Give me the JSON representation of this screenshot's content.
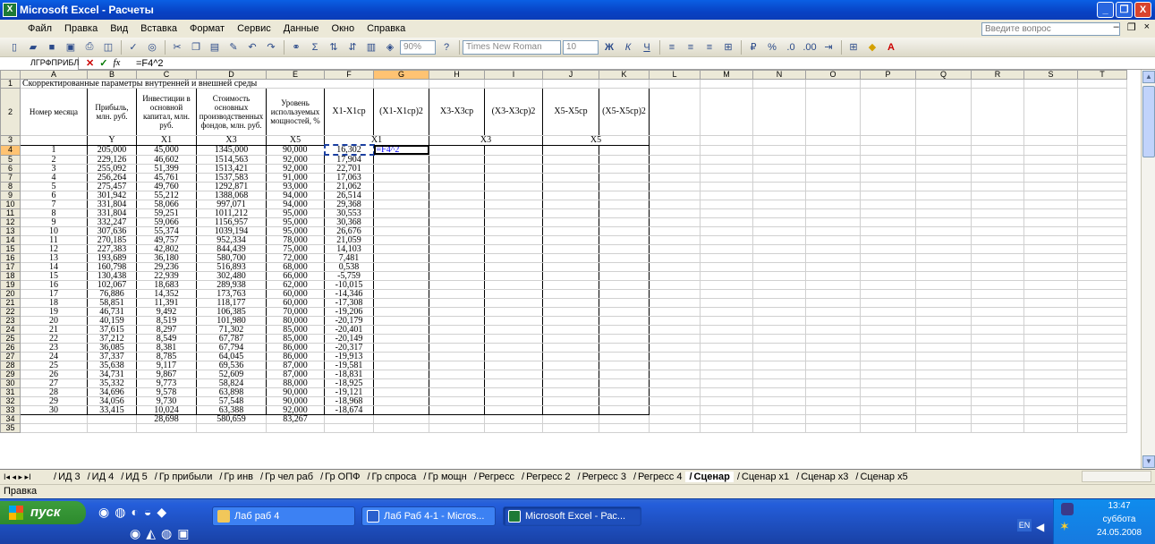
{
  "window": {
    "title": "Microsoft Excel - Расчеты",
    "minimize": "_",
    "restore": "❐",
    "close": "X"
  },
  "menu": [
    "Файл",
    "Правка",
    "Вид",
    "Вставка",
    "Формат",
    "Сервис",
    "Данные",
    "Окно",
    "Справка"
  ],
  "ask_placeholder": "Введите вопрос",
  "toolbar": {
    "zoom": "90%",
    "font": "Times New Roman",
    "size": "10",
    "bold": "Ж",
    "italic": "К",
    "underline": "Ч",
    "percent": "%"
  },
  "formula_bar": {
    "name_box": "ЛГРФПРИБЛ",
    "formula": "=F4^2",
    "cancel": "✕",
    "enter": "✓",
    "fx": "fx"
  },
  "columns": [
    "A",
    "B",
    "C",
    "D",
    "E",
    "F",
    "G",
    "H",
    "I",
    "J",
    "K",
    "L",
    "M",
    "N",
    "O",
    "P",
    "Q",
    "R",
    "S",
    "T"
  ],
  "sheet": {
    "title": "Скорректированные параметры внутренней и внешней среды",
    "headers": {
      "a": "Номер месяца",
      "b": "Прибыль, млн. руб.",
      "c": "Инвестиции в основной капитал, млн. руб.",
      "d": "Стоимость основных производственных фондов, млн. руб.",
      "e": "Уровень используемых мощностей, %",
      "f": "X1-X1ср",
      "g": "(X1-X1ср)2",
      "h": "X3-X3ср",
      "i": "(X3-X3ср)2",
      "j": "X5-X5ср",
      "k": "(X5-X5ср)2"
    },
    "vars": {
      "b": "Y",
      "c": "X1",
      "d": "X3",
      "e": "X5",
      "fg": "X1",
      "hi": "X3",
      "jk": "X5"
    },
    "editing_cell": "=F4^2",
    "rows": [
      [
        "1",
        "205,000",
        "45,000",
        "1345,000",
        "90,000",
        "16,302"
      ],
      [
        "2",
        "229,126",
        "46,602",
        "1514,563",
        "92,000",
        "17,904"
      ],
      [
        "3",
        "255,092",
        "51,399",
        "1513,421",
        "92,000",
        "22,701"
      ],
      [
        "4",
        "256,264",
        "45,761",
        "1537,583",
        "91,000",
        "17,063"
      ],
      [
        "5",
        "275,457",
        "49,760",
        "1292,871",
        "93,000",
        "21,062"
      ],
      [
        "6",
        "301,942",
        "55,212",
        "1388,068",
        "94,000",
        "26,514"
      ],
      [
        "7",
        "331,804",
        "58,066",
        "997,071",
        "94,000",
        "29,368"
      ],
      [
        "8",
        "331,804",
        "59,251",
        "1011,212",
        "95,000",
        "30,553"
      ],
      [
        "9",
        "332,247",
        "59,066",
        "1156,957",
        "95,000",
        "30,368"
      ],
      [
        "10",
        "307,636",
        "55,374",
        "1039,194",
        "95,000",
        "26,676"
      ],
      [
        "11",
        "270,185",
        "49,757",
        "952,334",
        "78,000",
        "21,059"
      ],
      [
        "12",
        "227,383",
        "42,802",
        "844,439",
        "75,000",
        "14,103"
      ],
      [
        "13",
        "193,689",
        "36,180",
        "580,700",
        "72,000",
        "7,481"
      ],
      [
        "14",
        "160,798",
        "29,236",
        "516,893",
        "68,000",
        "0,538"
      ],
      [
        "15",
        "130,438",
        "22,939",
        "302,480",
        "66,000",
        "-5,759"
      ],
      [
        "16",
        "102,067",
        "18,683",
        "289,938",
        "62,000",
        "-10,015"
      ],
      [
        "17",
        "76,886",
        "14,352",
        "173,763",
        "60,000",
        "-14,346"
      ],
      [
        "18",
        "58,851",
        "11,391",
        "118,177",
        "60,000",
        "-17,308"
      ],
      [
        "19",
        "46,731",
        "9,492",
        "106,385",
        "70,000",
        "-19,206"
      ],
      [
        "20",
        "40,159",
        "8,519",
        "101,980",
        "80,000",
        "-20,179"
      ],
      [
        "21",
        "37,615",
        "8,297",
        "71,302",
        "85,000",
        "-20,401"
      ],
      [
        "22",
        "37,212",
        "8,549",
        "67,787",
        "85,000",
        "-20,149"
      ],
      [
        "23",
        "36,085",
        "8,381",
        "67,794",
        "86,000",
        "-20,317"
      ],
      [
        "24",
        "37,337",
        "8,785",
        "64,045",
        "86,000",
        "-19,913"
      ],
      [
        "25",
        "35,638",
        "9,117",
        "69,536",
        "87,000",
        "-19,581"
      ],
      [
        "26",
        "34,731",
        "9,867",
        "52,609",
        "87,000",
        "-18,831"
      ],
      [
        "27",
        "35,332",
        "9,773",
        "58,824",
        "88,000",
        "-18,925"
      ],
      [
        "28",
        "34,696",
        "9,578",
        "63,898",
        "90,000",
        "-19,121"
      ],
      [
        "29",
        "34,056",
        "9,730",
        "57,548",
        "90,000",
        "-18,968"
      ],
      [
        "30",
        "33,415",
        "10,024",
        "63,388",
        "92,000",
        "-18,674"
      ]
    ],
    "averages": [
      "28,698",
      "580,659",
      "83,267"
    ]
  },
  "tabs": [
    "ИД 3",
    "ИД 4",
    "ИД 5",
    "Гр прибыли",
    "Гр инв",
    "Гр чел раб",
    "Гр ОПФ",
    "Гр спроса",
    "Гр мощн",
    "Регресс",
    "Регресс 2",
    "Регресс 3",
    "Регресс 4",
    "Сценар",
    "Сценар x1",
    "Сценар x3",
    "Сценар x5"
  ],
  "active_tab": "Сценар",
  "status": "Правка",
  "taskbar": {
    "start": "пуск",
    "tasks": [
      "Лаб раб 4",
      "Лаб Раб 4-1 - Micros...",
      "Microsoft Excel - Рас..."
    ],
    "lang": "EN",
    "time": "13:47",
    "day": "суббота",
    "date": "24.05.2008"
  }
}
